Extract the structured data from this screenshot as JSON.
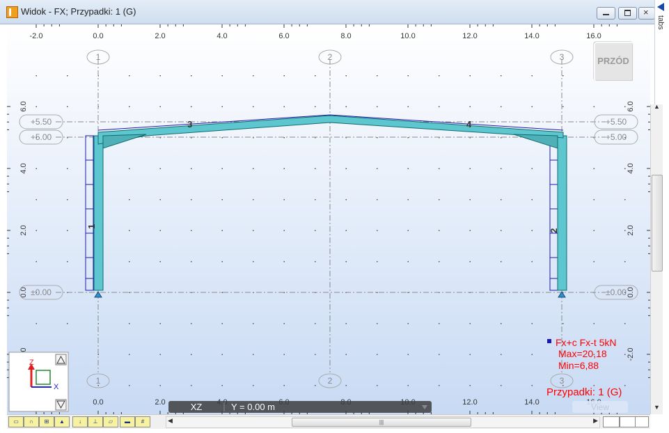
{
  "window": {
    "title": "Widok - FX; Przypadki: 1 (G)",
    "tabs_label": "tabs"
  },
  "view": {
    "nav_cube_label": "PRZÓD",
    "plane_label": "XZ",
    "coord_label": "Y = 0.00 m",
    "view_label": "View"
  },
  "axes": {
    "x_ticks": [
      "-2.0",
      "0.0",
      "2.0",
      "4.0",
      "6.0",
      "8.0",
      "10.0",
      "12.0",
      "14.0",
      "16.0"
    ],
    "z_ticks": [
      "6.0",
      "4.0",
      "2.0",
      "0.0",
      "-2.0"
    ],
    "grid_labels": [
      "1",
      "2",
      "3"
    ],
    "levels": [
      "+5.50",
      "+5.00",
      "±0.00"
    ]
  },
  "members": [
    "1",
    "2",
    "3",
    "4"
  ],
  "legend": {
    "line1": "Fx+c Fx-t  5kN",
    "line2": "Max=20,18",
    "line3": "Min=6,88",
    "case": "Przypadki: 1 (G)"
  },
  "triad": {
    "z": "Z",
    "x": "X"
  },
  "colors": {
    "canvas_top": "#ffffff",
    "canvas_bottom": "#c8daf4",
    "member_fill": "#5ec6cf",
    "member_edge": "#0d6b70",
    "diagram": "#1a1ab0",
    "legend_text": "#ff0000",
    "grid_line": "#8a8a8a"
  },
  "toolbar_icons": [
    "frame-icon",
    "portal-icon",
    "section-icon",
    "support-icon",
    "load-icon",
    "dimension-icon",
    "plane-icon",
    "ruler-icon",
    "numbering-icon"
  ]
}
